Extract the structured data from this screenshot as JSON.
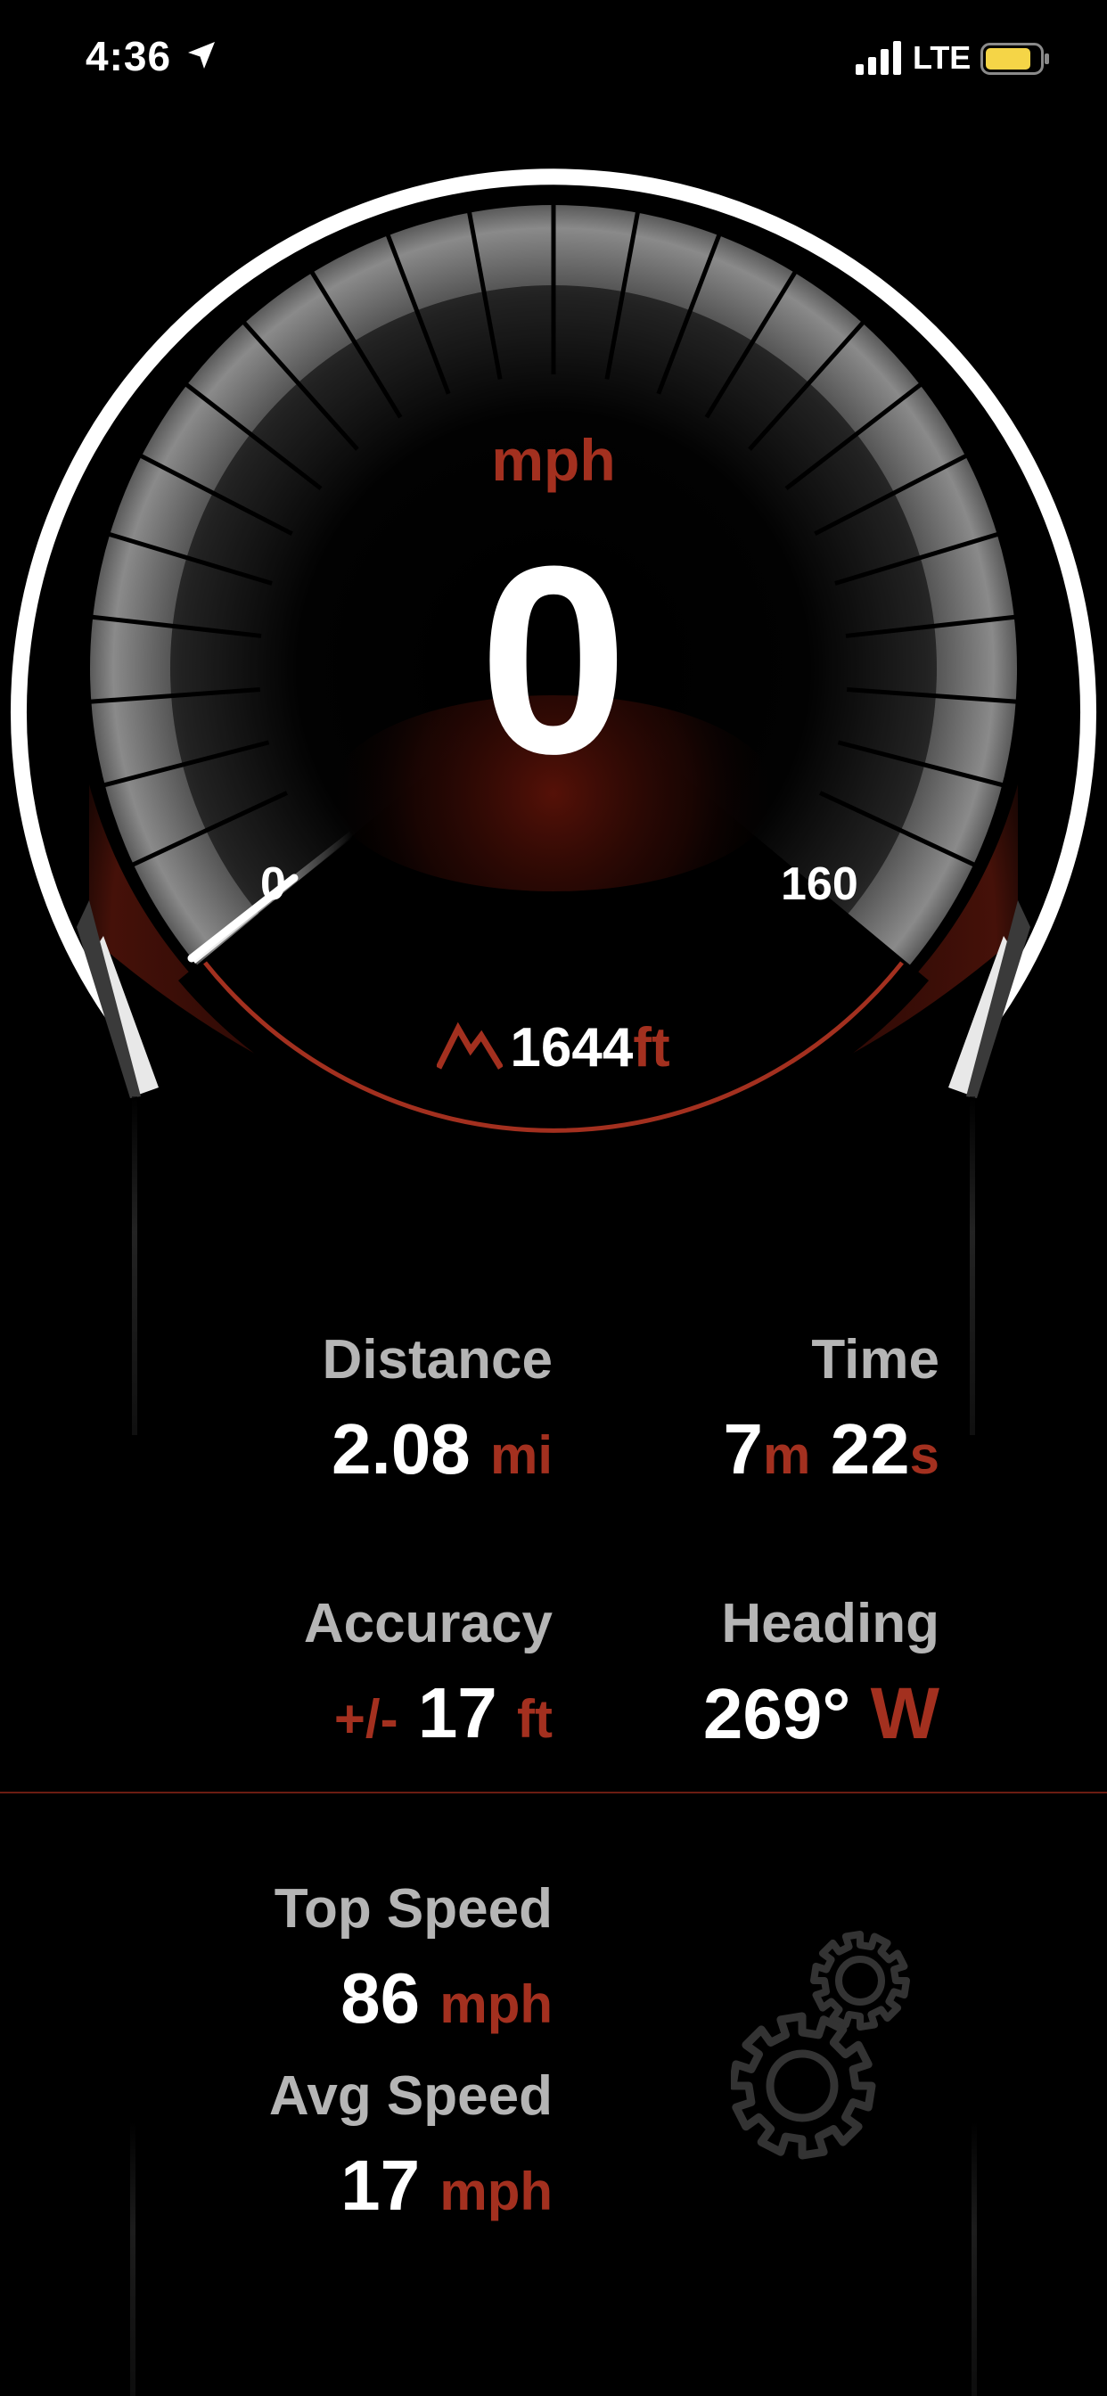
{
  "status_bar": {
    "time": "4:36",
    "network": "LTE"
  },
  "gauge": {
    "unit": "mph",
    "speed": "0",
    "scale_min": "0",
    "scale_max": "160",
    "speed_fraction": 0,
    "altitude_value": "1644",
    "altitude_unit": "ft"
  },
  "stats": {
    "distance": {
      "label": "Distance",
      "value": "2.08",
      "unit": "mi"
    },
    "time": {
      "label": "Time",
      "minutes": "7",
      "minutes_unit": "m",
      "seconds": "22",
      "seconds_unit": "s"
    },
    "accuracy": {
      "label": "Accuracy",
      "prefix": "+/-",
      "value": "17",
      "unit": "ft"
    },
    "heading": {
      "label": "Heading",
      "value": "269°",
      "direction": "W"
    },
    "top_speed": {
      "label": "Top Speed",
      "value": "86",
      "unit": "mph"
    },
    "avg_speed": {
      "label": "Avg Speed",
      "value": "17",
      "unit": "mph"
    }
  },
  "icons": {
    "settings": "gears-icon",
    "altitude": "mountain-icon",
    "location": "location-arrow-icon"
  },
  "colors": {
    "accent": "#a3301f",
    "background": "#000000",
    "battery": "#f5d547"
  }
}
